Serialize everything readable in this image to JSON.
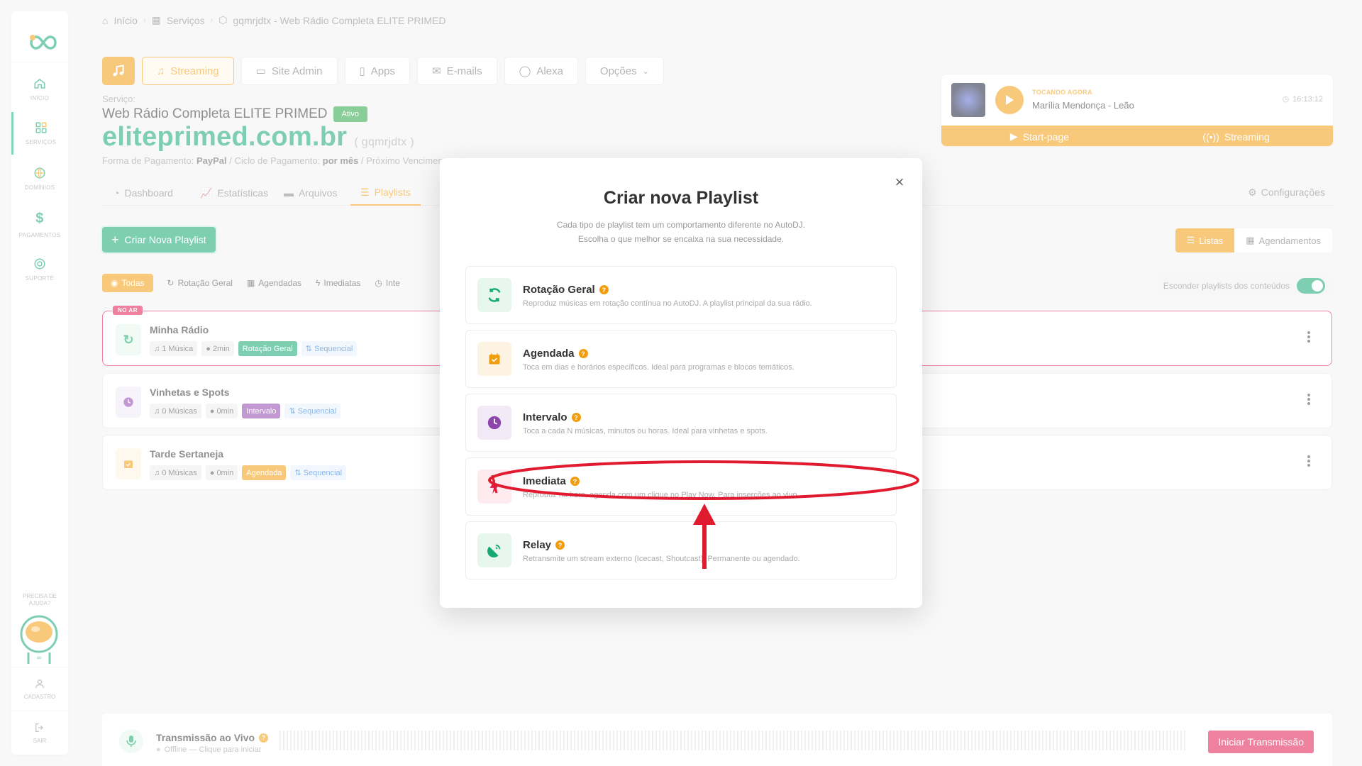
{
  "sidebar": {
    "items": [
      {
        "label": "INÍCIO",
        "icon": "home-icon"
      },
      {
        "label": "SERVIÇOS",
        "icon": "grid-icon"
      },
      {
        "label": "DOMÍNIOS",
        "icon": "globe-icon"
      },
      {
        "label": "PAGAMENTOS",
        "icon": "dollar-icon"
      },
      {
        "label": "SUPORTE",
        "icon": "lifebuoy-icon"
      }
    ],
    "help": "PRECISA DE AJUDA?",
    "cadastro": "CADASTRO",
    "sair": "SAIR"
  },
  "breadcrumb": {
    "home": "Início",
    "services": "Serviços",
    "current": "gqmrjdtx - Web Rádio Completa ELITE PRIMED"
  },
  "tabs": {
    "streaming": "Streaming",
    "site_admin": "Site Admin",
    "apps": "Apps",
    "emails": "E-mails",
    "alexa": "Alexa",
    "opcoes": "Opções"
  },
  "service": {
    "label": "Serviço:",
    "name": "Web Rádio Completa ELITE PRIMED",
    "status": "Ativo",
    "domain": "eliteprimed.com.br",
    "code": "( gqmrjdtx )",
    "pay_label": "Forma de Pagamento:",
    "pay_method": "PayPal",
    "cycle_label": "/ Ciclo de Pagamento:",
    "cycle": "por mês",
    "due_label": "/ Próximo Vencimento:"
  },
  "subtabs": {
    "dashboard": "Dashboard",
    "estatisticas": "Estatísticas",
    "arquivos": "Arquivos",
    "playlists": "Playlists",
    "configuracoes": "Configurações"
  },
  "create_button": "Criar Nova Playlist",
  "view_toggle": {
    "listas": "Listas",
    "agendamentos": "Agendamentos"
  },
  "filters": {
    "todas": "Todas",
    "rotacao": "Rotação Geral",
    "agendadas": "Agendadas",
    "imediatas": "Imediatas",
    "inte": "Inte"
  },
  "hide_toggle": "Esconder playlists dos conteúdos",
  "playlists": [
    {
      "badge": "NO AR",
      "title": "Minha Rádio",
      "songs": "1 Música",
      "duration": "2min",
      "type": "Rotação Geral",
      "order": "Sequencial"
    },
    {
      "title": "Vinhetas e Spots",
      "songs": "0 Músicas",
      "duration": "0min",
      "type": "Intervalo",
      "order": "Sequencial"
    },
    {
      "title": "Tarde Sertaneja",
      "songs": "0 Músicas",
      "duration": "0min",
      "type": "Agendada",
      "order": "Sequencial"
    }
  ],
  "now_playing": {
    "label": "TOCANDO AGORA",
    "song": "Marília Mendonça - Leão",
    "time": "16:13:12",
    "start_page": "Start-page",
    "streaming": "Streaming"
  },
  "live": {
    "title": "Transmissão ao Vivo",
    "status": "Offline — Clique para iniciar",
    "button": "Iniciar Transmissão"
  },
  "modal": {
    "close": "×",
    "title": "Criar nova Playlist",
    "desc1": "Cada tipo de playlist tem um comportamento diferente no AutoDJ.",
    "desc2": "Escolha o que melhor se encaixa na sua necessidade.",
    "options": [
      {
        "title": "Rotação Geral",
        "desc": "Reproduz músicas em rotação contínua no AutoDJ. A playlist principal da sua rádio.",
        "color": "#14a874"
      },
      {
        "title": "Agendada",
        "desc": "Toca em dias e horários específicos. Ideal para programas e blocos temáticos.",
        "color": "#f29d0e"
      },
      {
        "title": "Intervalo",
        "desc": "Toca a cada N músicas, minutos ou horas. Ideal para vinhetas e spots.",
        "color": "#8e44ad"
      },
      {
        "title": "Imediata",
        "desc": "Reproduz na hora, agenda com um clique no Play Now. Para inserções ao vivo.",
        "color": "#e01a4f"
      },
      {
        "title": "Relay",
        "desc": "Retransmite um stream externo (Icecast, Shoutcast). Permanente ou agendado.",
        "color": "#14a874"
      }
    ]
  },
  "colors": {
    "accent": "#f29d0e",
    "brand": "#14a874",
    "danger": "#e01a4f",
    "annotation": "#e01a2f"
  }
}
